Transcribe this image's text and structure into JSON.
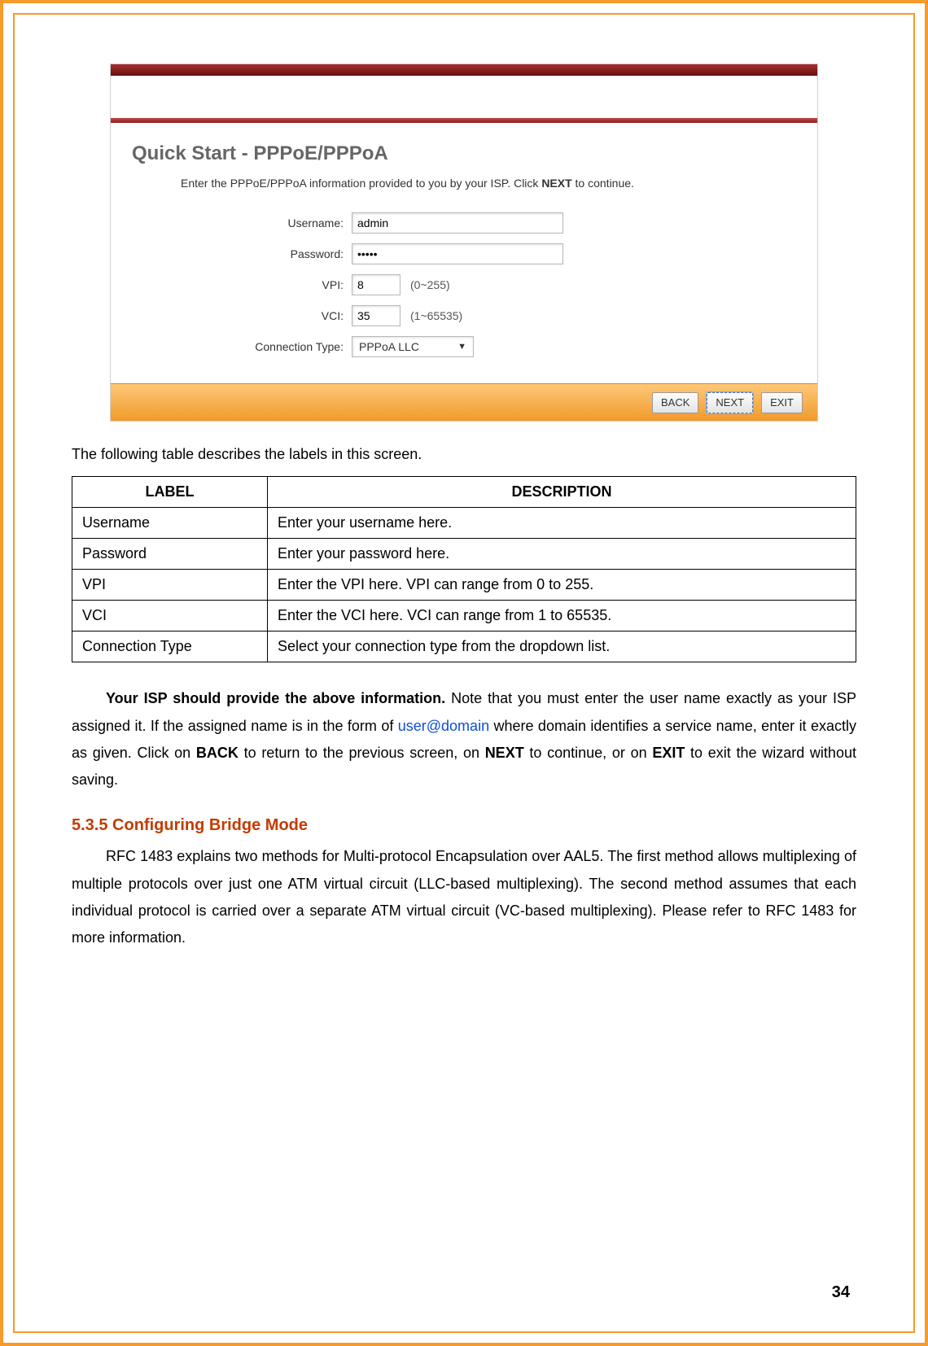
{
  "screenshot": {
    "title": "Quick Start - PPPoE/PPPoA",
    "instruction_prefix": "Enter the PPPoE/PPPoA information provided to you by your ISP. Click ",
    "instruction_bold": "NEXT",
    "instruction_suffix": " to continue.",
    "form": {
      "username_label": "Username:",
      "username_value": "admin",
      "password_label": "Password:",
      "password_value": "•••••",
      "vpi_label": "VPI:",
      "vpi_value": "8",
      "vpi_range": "(0~255)",
      "vci_label": "VCI:",
      "vci_value": "35",
      "vci_range": "(1~65535)",
      "conn_type_label": "Connection Type:",
      "conn_type_value": "PPPoA LLC"
    },
    "buttons": {
      "back": "BACK",
      "next": "NEXT",
      "exit": "EXIT"
    }
  },
  "table_intro": "The following table describes the labels in this screen.",
  "table": {
    "head_label": "LABEL",
    "head_desc": "DESCRIPTION",
    "rows": [
      {
        "label": "Username",
        "desc": "Enter your username here."
      },
      {
        "label": "Password",
        "desc": "Enter your password here."
      },
      {
        "label": "VPI",
        "desc": "Enter the VPI here. VPI can range from 0 to 255."
      },
      {
        "label": "VCI",
        "desc": "Enter the VCI here. VCI can range from 1 to 65535."
      },
      {
        "label": "Connection Type",
        "desc": "Select your connection type from the dropdown list."
      }
    ]
  },
  "para1": {
    "lead_bold": "Your ISP should provide the above information.",
    "t1": " Note that you must enter the user name exactly as your ISP assigned it. If the assigned name is in the form of ",
    "link": "user@domain",
    "t2": " where domain identifies a service name, enter it exactly as given. Click on ",
    "b_back": "BACK",
    "t3": " to return to the previous screen, on ",
    "b_next": "NEXT",
    "t4": " to continue, or on ",
    "b_exit": "EXIT",
    "t5": " to exit the wizard without saving."
  },
  "section_heading": "5.3.5 Configuring Bridge Mode",
  "para2": "RFC 1483 explains two methods for Multi-protocol Encapsulation over AAL5. The first method allows multiplexing of multiple protocols over just one ATM virtual circuit (LLC-based multiplexing). The second method assumes that each individual protocol is carried over a separate ATM virtual circuit (VC-based multiplexing). Please refer to RFC 1483 for more information.",
  "page_number": "34"
}
